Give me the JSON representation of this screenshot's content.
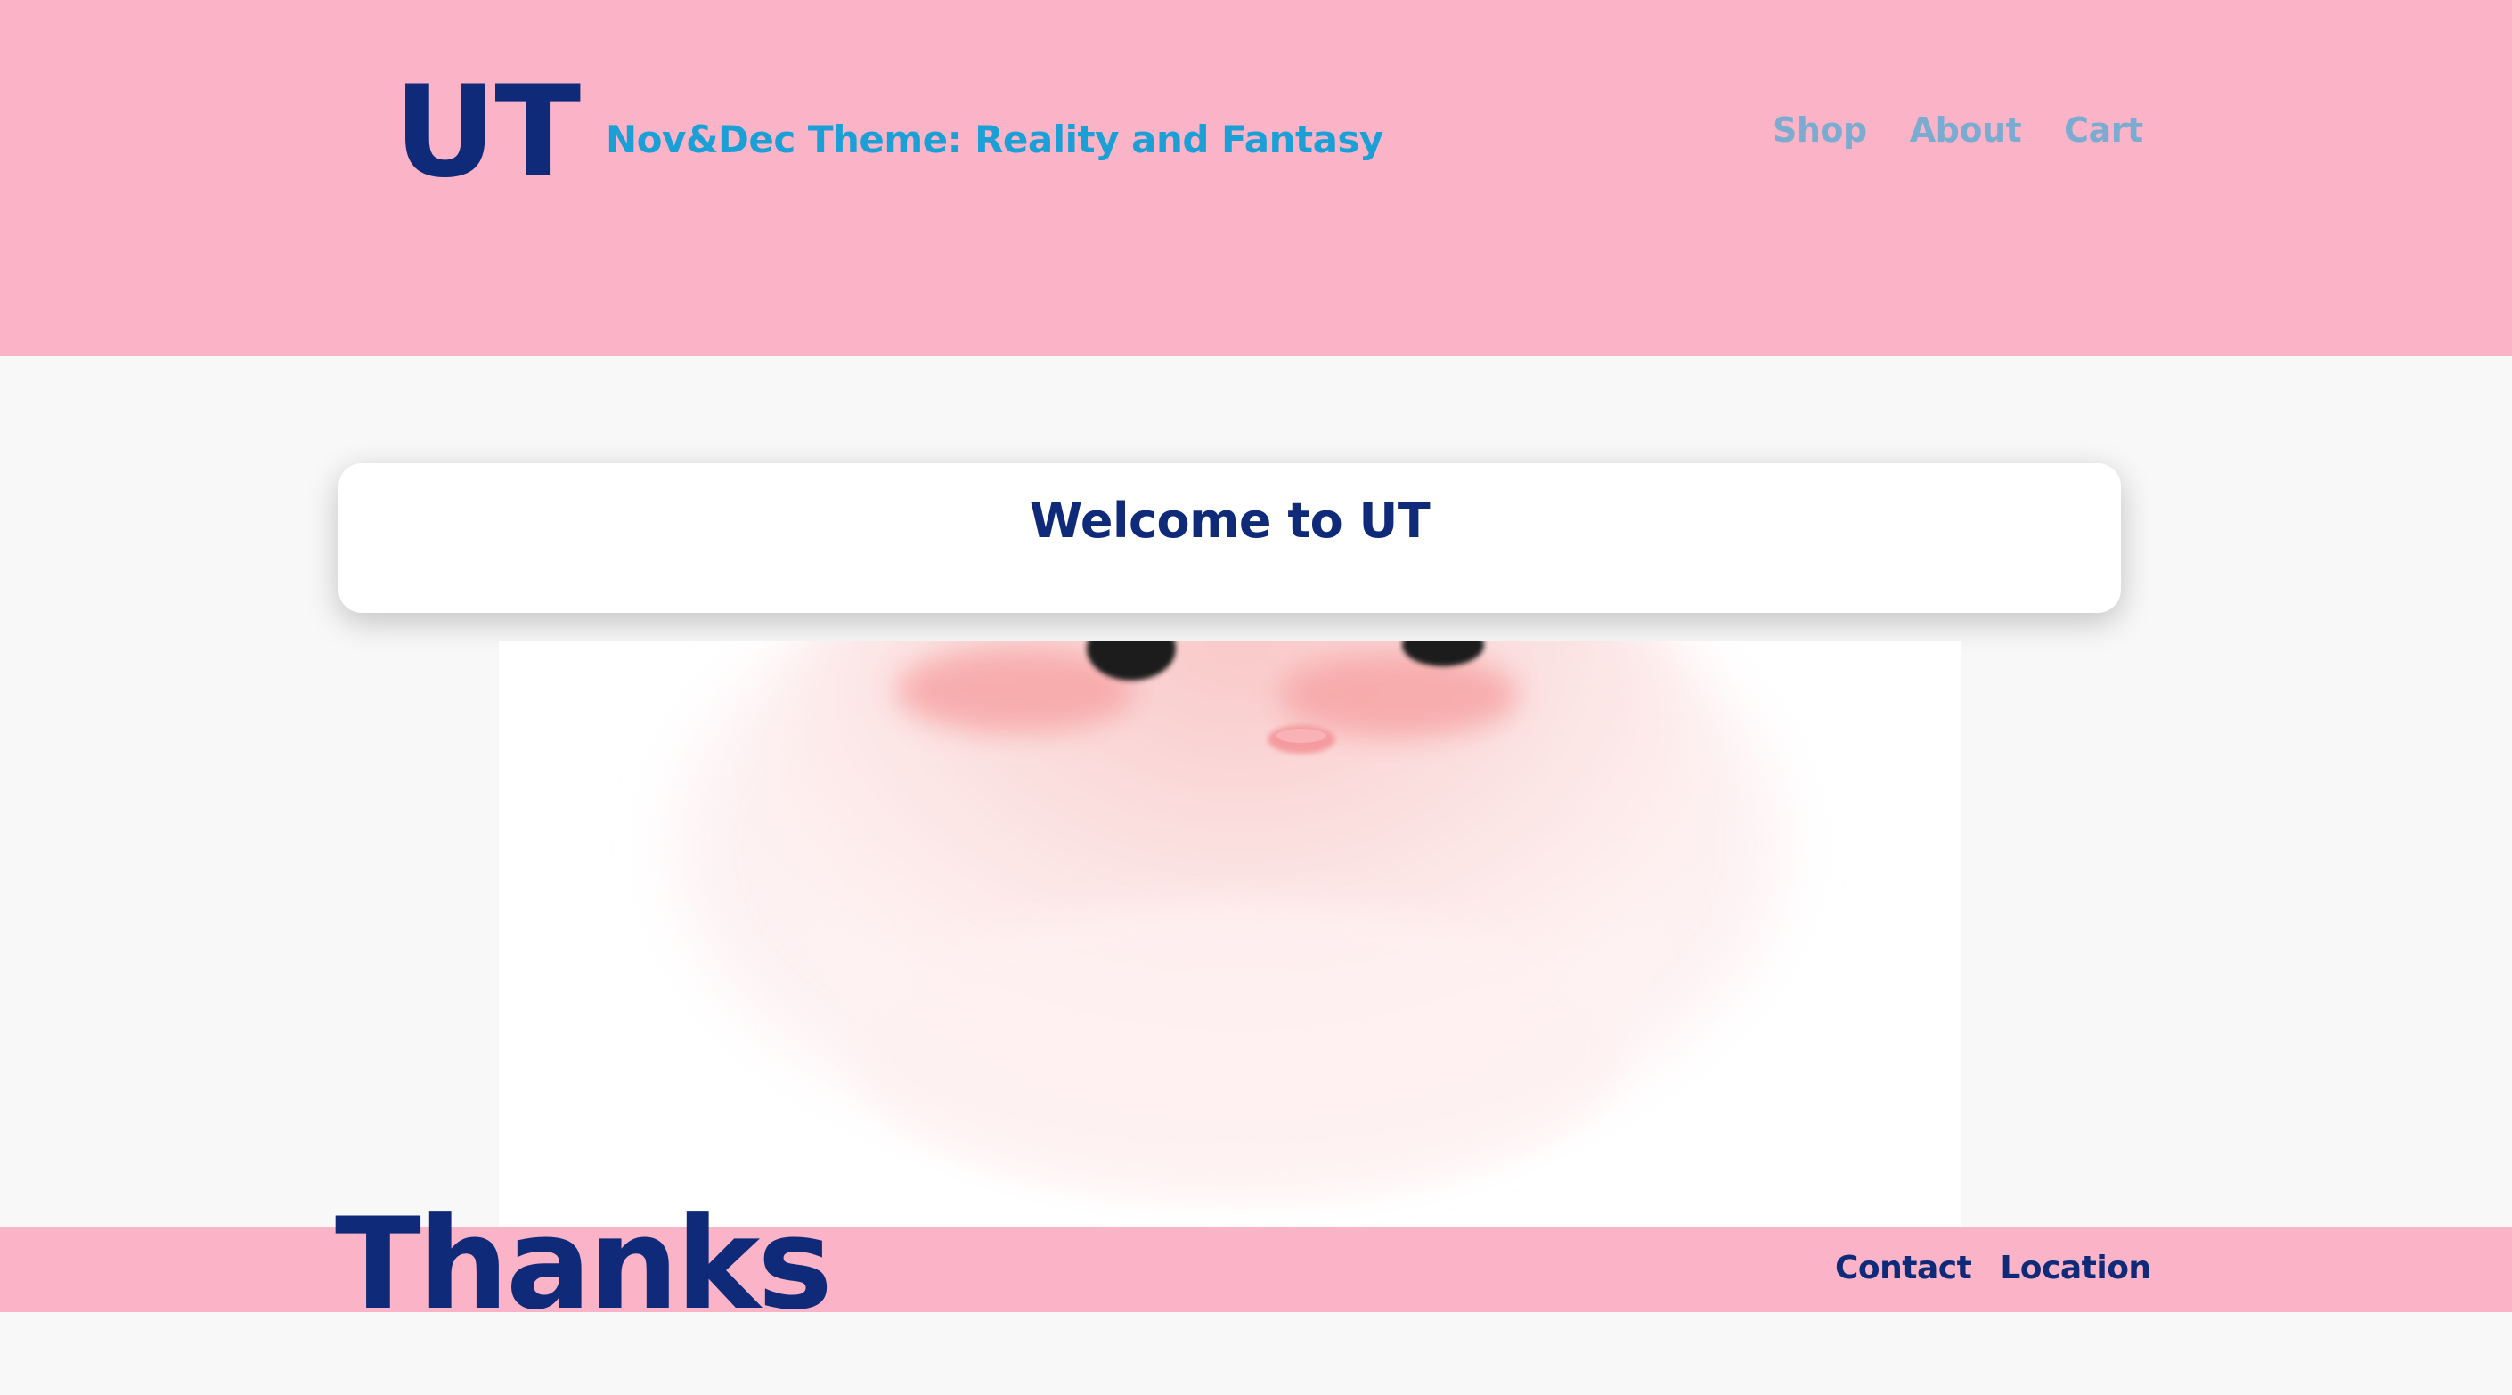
{
  "header": {
    "logo": "UT",
    "theme": "Nov&Dec Theme: Reality and Fantasy",
    "nav": [
      {
        "label": "Shop"
      },
      {
        "label": "About"
      },
      {
        "label": "Cart"
      }
    ]
  },
  "welcome": {
    "title": "Welcome to UT"
  },
  "hero": {
    "description": "Watercolor illustration of a fluffy pink creature with dark eyes, rosy cheeks and a small pink nose"
  },
  "footer": {
    "title": "Thanks",
    "links": [
      {
        "label": "Contact"
      },
      {
        "label": "Location"
      }
    ]
  },
  "colors": {
    "pink": "#fbb4c7",
    "navy": "#0f2a78",
    "sky": "#1aa0d6",
    "nav_link": "#7aabd0",
    "background": "#f8f8f8"
  }
}
